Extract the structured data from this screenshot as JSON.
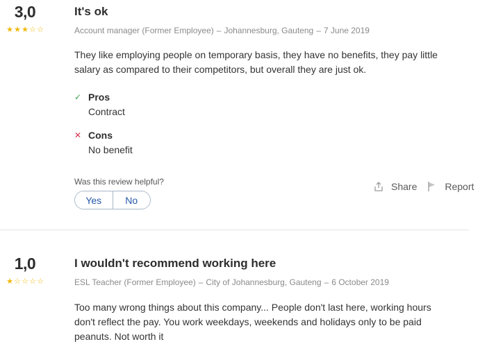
{
  "reviews": [
    {
      "rating": "3,0",
      "stars_filled": 3,
      "stars_total": 5,
      "title": "It's ok",
      "role": "Account manager (Former Employee)",
      "sep1": "–",
      "location": "Johannesburg, Gauteng",
      "sep2": "–",
      "date": "7 June 2019",
      "text": "They like employing people on temporary basis, they have no benefits, they pay little salary as compared to their competitors, but overall they are just ok.",
      "pros_label": "Pros",
      "pros": "Contract",
      "cons_label": "Cons",
      "cons": "No benefit",
      "helpful_label": "Was this review helpful?",
      "yes_label": "Yes",
      "no_label": "No",
      "share_label": "Share",
      "report_label": "Report"
    },
    {
      "rating": "1,0",
      "stars_filled": 1,
      "stars_total": 5,
      "title": "I wouldn't recommend working here",
      "role": "ESL Teacher (Former Employee)",
      "sep1": "–",
      "location": "City of Johannesburg, Gauteng",
      "sep2": "–",
      "date": "6 October 2019",
      "text": "Too many wrong things about this company... People don't last here, working hours don't reflect the pay. You work weekdays, weekends and holidays only to be paid peanuts. Not worth it"
    }
  ],
  "colors": {
    "star": "#f1b80a",
    "pro_check": "#3d9c4a",
    "con_cross": "#d1334e",
    "link_blue": "#2557a7"
  }
}
